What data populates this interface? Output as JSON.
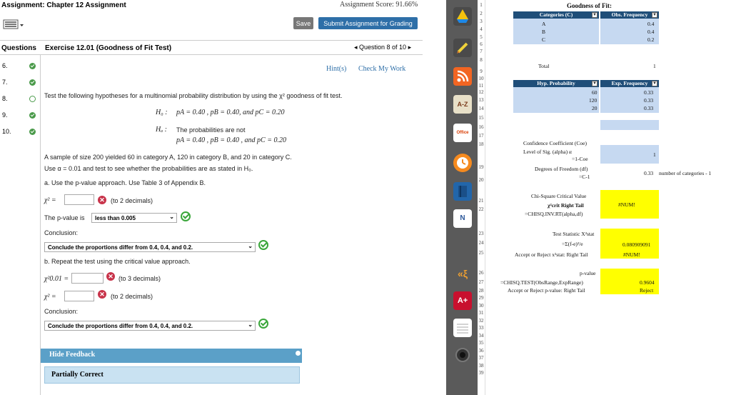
{
  "header": {
    "title": "Assignment: Chapter 12 Assignment",
    "score": "Assignment Score: 91.66%",
    "save_label": "Save",
    "submit_label": "Submit Assignment for Grading"
  },
  "questions": {
    "header": "Questions",
    "items": [
      "6.",
      "7.",
      "8.",
      "9.",
      "10."
    ]
  },
  "exercise": {
    "title": "Exercise 12.01 (Goodness of Fit Test)",
    "nav": "◂ Question 8 of 10 ▸",
    "hint": "Hint(s)",
    "check": "Check My Work",
    "intro": "Test the following hypotheses for a multinomial probability distribution by using the χ² goodness of fit test.",
    "h0_label": "H₀ :",
    "h0": "pA = 0.40 , pB = 0.40,  and  pC = 0.20",
    "ha_label": "Hₐ :",
    "ha1": "The probabilities are not",
    "ha2": "pA = 0.40 , pB = 0.40 , and pC = 0.20",
    "sample": "A sample of size 200 yielded 60 in category A, 120 in category B, and 20 in category C.",
    "use": "Use α = 0.01 and test to see whether the probabilities are as stated in H₀.",
    "part_a": "a. Use the p-value approach. Use Table 3 of Appendix B.",
    "chi_label": "χ² =",
    "chi_hint": "(to 2 decimals)",
    "pval_label": "The p-value is",
    "pval_value": "less than 0.005",
    "conclusion_label": "Conclusion:",
    "conclusion_a": "Conclude the proportions differ from 0.4, 0.4, and 0.2.",
    "part_b": "b. Repeat the test using the critical value approach.",
    "chi01_label": "χ²0.01 =",
    "chi01_hint": "(to 3 decimals)",
    "chi_b_label": "χ² =",
    "chi_b_hint": "(to 2 decimals)",
    "conclusion_b": "Conclude the proportions differ from 0.4, 0.4, and 0.2.",
    "feedback_toggle": "Hide Feedback",
    "feedback_status": "Partially Correct"
  },
  "sheet": {
    "title": "Goodness of Fit:",
    "col1_hdr": "Categories (C)",
    "col2_hdr": "Obs. Frequency",
    "cats": [
      "A",
      "B",
      "C"
    ],
    "obs": [
      "0.4",
      "0.4",
      "0.2"
    ],
    "total_label": "Total",
    "total_val": "1",
    "hyp_hdr": "Hyp. Probability",
    "exp_hdr": "Exp. Frequency",
    "hyp_vals": [
      "60",
      "120",
      "20"
    ],
    "exp_vals": [
      "0.33",
      "0.33",
      "0.33"
    ],
    "conf_label": "Confidence Coefficient (Coe)",
    "sig_label": "Level of Sig. (alpha) α",
    "sig_formula": "=1-Coe",
    "sig_val": "1",
    "df_label": "Degrees of Freedom (df)",
    "df_formula": "=C-1",
    "df_val": "0.33",
    "df_note": "number of categories - 1",
    "chi_crit_label": "Chi-Square Critical Value",
    "chi_crit_label2": "χ²crit Right Tail",
    "chi_crit_formula": "=CHISQ.INV.RT(alpha,df)",
    "chi_crit_val": "#NUM!",
    "test_stat_label": "Test Statistic X²stat",
    "test_stat_formula": "=Σ(f-e)²/e",
    "test_stat_val": "0.080909091",
    "accept_label": "Accept or Reject x²stat: Right Tail",
    "accept_val": "#NUM!",
    "pvalue_label": "p-value",
    "pvalue_formula": "=CHISQ.TEST(ObsRange,ExpRange)",
    "pvalue_val": "0.9604",
    "accept_p_label": "Accept or Reject p-value: Right Tail",
    "accept_p_val": "Reject",
    "rows": [
      "1",
      "2",
      "3",
      "4",
      "5",
      "6",
      "7",
      "8",
      "9",
      "10",
      "11",
      "12",
      "13",
      "14",
      "15",
      "16",
      "17",
      "18",
      "19",
      "20",
      "21",
      "22",
      "23",
      "24",
      "25",
      "26",
      "27",
      "28",
      "29",
      "30",
      "31",
      "32",
      "33",
      "34",
      "35",
      "36",
      "37",
      "38",
      "39"
    ]
  },
  "dock": {
    "icons": [
      "google-drive-icon",
      "pen-icon",
      "rss-icon",
      "az-dictionary-icon",
      "office-icon",
      "clock-icon",
      "book-icon",
      "onenote-icon",
      "voice-icon",
      "acrobat-icon",
      "notes-icon",
      "camera-icon"
    ]
  }
}
